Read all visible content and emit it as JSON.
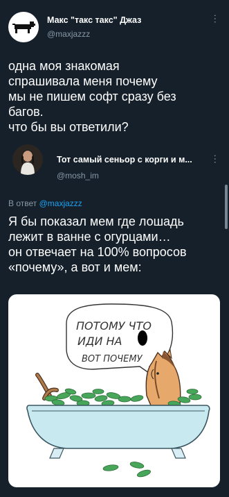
{
  "tweet1": {
    "author_name": "Макс \"такс такс\" Джаз",
    "handle": "@maxjazzz",
    "text": "одна моя знакомая\nспрашивала меня почему\nмы не пишем софт сразу без\nбагов.\nчто бы вы ответили?",
    "more_icon": "more-vertical-icon"
  },
  "tweet2": {
    "author_name": "Тот самый сеньор с корги и м...",
    "handle": "@mosh_im",
    "replying_prefix": "В ответ",
    "replying_to": "@maxjazzz",
    "text": "Я бы показал мем где лошадь\nлежит в ванне с огурцами…\nон отвечает на 100% вопросов\n«почему», а вот и мем:",
    "more_icon": "more-vertical-icon"
  },
  "meme": {
    "bubble_line1": "ПОТОМУ ЧТО",
    "bubble_line2": "ИДИ НА",
    "bubble_line3": "ВОТ ПОЧЕМУ"
  }
}
